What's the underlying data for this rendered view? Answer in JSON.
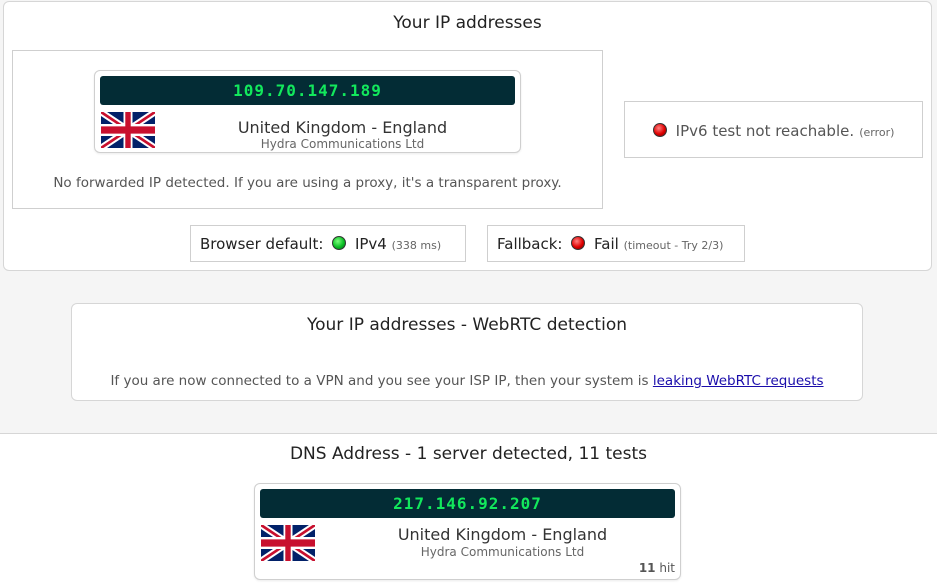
{
  "ip_section": {
    "title": "Your IP addresses",
    "ip": "109.70.147.189",
    "country": "United Kingdom - England",
    "isp": "Hydra Communications Ltd",
    "forward_note": "No forwarded IP detected. If you are using a proxy, it's a transparent proxy.",
    "ipv6_text": "IPv6 test not reachable.",
    "ipv6_error": "(error)",
    "browser_default_label": "Browser default:",
    "browser_default_value": "IPv4",
    "browser_default_time": "(338 ms)",
    "fallback_label": "Fallback:",
    "fallback_value": "Fail",
    "fallback_detail": "(timeout - Try 2/3)"
  },
  "webrtc_section": {
    "title": "Your IP addresses - WebRTC detection",
    "note": "If you are now connected to a VPN and you see your ISP IP, then your system is",
    "link_text": "leaking WebRTC requests"
  },
  "dns_section": {
    "title": "DNS Address - 1 server detected, 11 tests",
    "ip": "217.146.92.207",
    "country": "United Kingdom - England",
    "isp": "Hydra Communications Ltd",
    "hits_count": "11",
    "hits_label": "hit"
  },
  "colors": {
    "ip_bar_bg": "#032c35",
    "ip_text": "#12e85c",
    "status_ok": "#0bbf25",
    "status_fail": "#e00000"
  }
}
